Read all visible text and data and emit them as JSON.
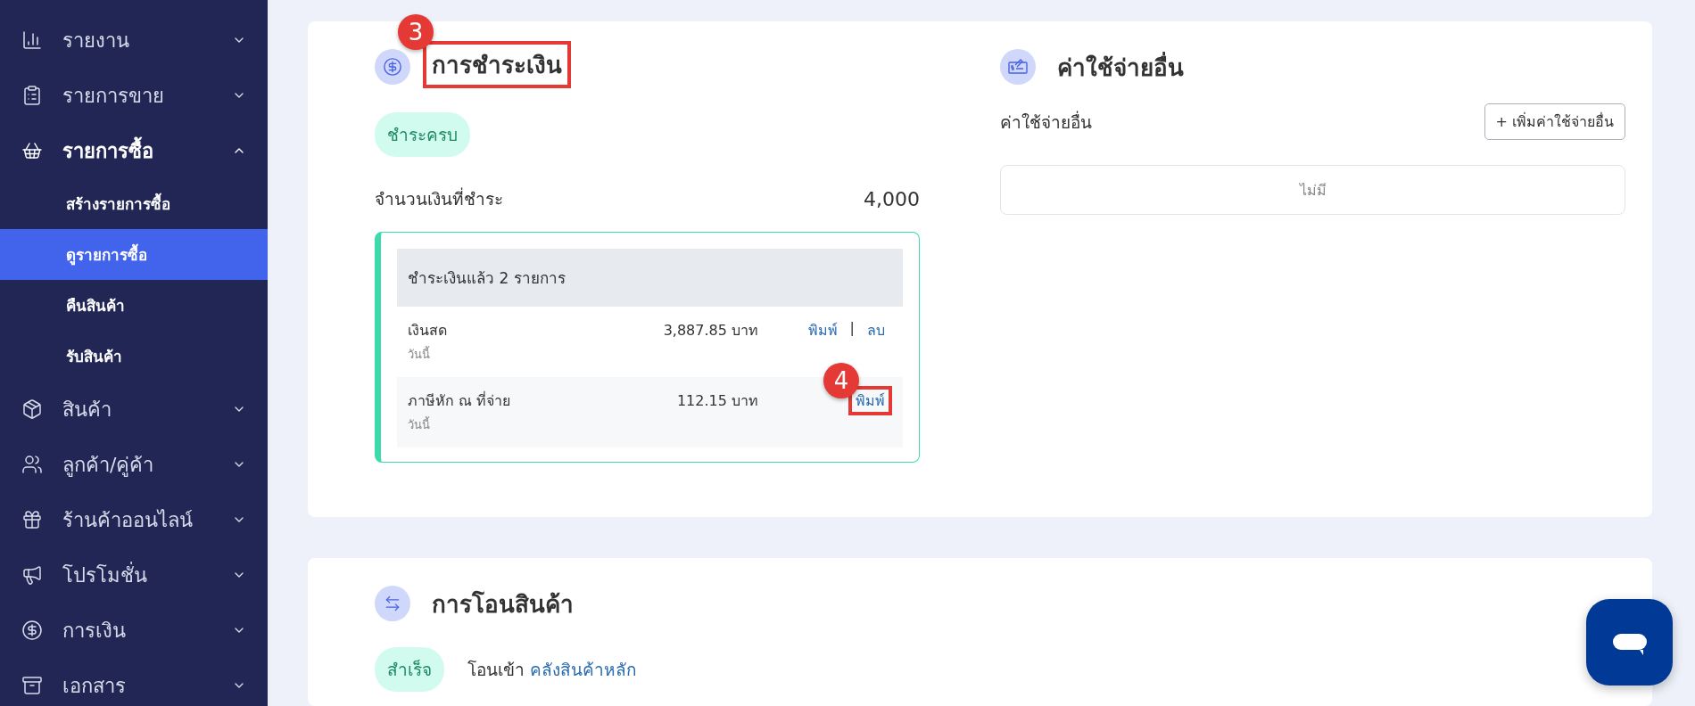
{
  "sidebar": {
    "items": [
      {
        "label": "รายงาน",
        "expanded": false
      },
      {
        "label": "รายการขาย",
        "expanded": false
      },
      {
        "label": "รายการซื้อ",
        "expanded": true,
        "children": [
          {
            "label": "สร้างรายการซื้อ",
            "selected": false
          },
          {
            "label": "ดูรายการซื้อ",
            "selected": true
          },
          {
            "label": "คืนสินค้า",
            "selected": false
          },
          {
            "label": "รับสินค้า",
            "selected": false
          }
        ]
      },
      {
        "label": "สินค้า",
        "expanded": false
      },
      {
        "label": "ลูกค้า/คู่ค้า",
        "expanded": false
      },
      {
        "label": "ร้านค้าออนไลน์",
        "expanded": false
      },
      {
        "label": "โปรโมชั่น",
        "expanded": false
      },
      {
        "label": "การเงิน",
        "expanded": false
      },
      {
        "label": "เอกสาร",
        "expanded": false
      }
    ]
  },
  "payment": {
    "title": "การชำระเงิน",
    "title_marker": "3",
    "status": "ชำระครบ",
    "amount_label": "จำนวนเงินที่ชำระ",
    "amount": "4,000",
    "paid_header": "ชำระเงินแล้ว 2 รายการ",
    "separator": "|",
    "rows": [
      {
        "method": "เงินสด",
        "date": "วันนี้",
        "amount": "3,887.85 บาท",
        "actions": [
          {
            "label": "พิมพ์"
          },
          {
            "label": "ลบ"
          }
        ]
      },
      {
        "method": "ภาษีหัก ณ ที่จ่าย",
        "date": "วันนี้",
        "amount": "112.15 บาท",
        "actions": [
          {
            "label": "พิมพ์",
            "marker": "4"
          }
        ]
      }
    ]
  },
  "other_expenses": {
    "title": "ค่าใช้จ่ายอื่น",
    "label": "ค่าใช้จ่ายอื่น",
    "add_button": "+ เพิ่มค่าใช้จ่ายอื่น",
    "empty": "ไม่มี"
  },
  "transfer": {
    "title": "การโอนสินค้า",
    "status": "สำเร็จ",
    "text": "โอนเข้า",
    "link": "คลังสินค้าหลัก"
  }
}
